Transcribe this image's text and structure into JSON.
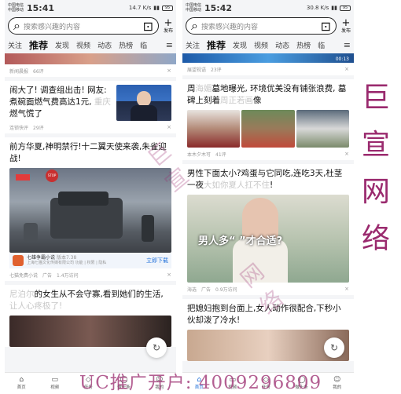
{
  "left": {
    "status": {
      "carrier1": "中国电信",
      "carrier2": "中国移动",
      "time": "15:41",
      "speed": "14.7 K/s",
      "battery": "95"
    },
    "search": {
      "placeholder": "搜索感兴趣的内容"
    },
    "publish_label": "发布",
    "tabs": [
      "关注",
      "推荐",
      "发现",
      "视频",
      "动态",
      "热榜",
      "临"
    ],
    "items": [
      {
        "source": "新闻晨报",
        "comments": "66评"
      },
      {
        "title_a": "闹大了! 调查组出击! 网友:",
        "title_b": "煮碗面燃气费高达1元, ",
        "title_blur": "重庆",
        "title_c": "燃气慌了",
        "source": "连锁快评",
        "comments": "29评"
      },
      {
        "title": "前方华夏,神明禁行!十二翼天使来袭,朱雀迎战!",
        "app_name": "七雄争霸小说",
        "app_ver": "版本7.38",
        "app_dev": "上海七猫文化传媒有限公司",
        "app_links": "功能 | 权限 | 隐私",
        "download": "立即下载",
        "source": "七猫免费小说",
        "ad": "广告",
        "downloads": "1.4万访问"
      },
      {
        "title_blur": "尼泊尔",
        "title_a": "的女生从不会守寡,看到她们的生活,",
        "title_b": "让人心疼极了!"
      }
    ],
    "nav": [
      "首页",
      "视频",
      "任务",
      "微头条",
      "我的"
    ]
  },
  "right": {
    "status": {
      "carrier1": "中国电信",
      "carrier2": "中国移动",
      "time": "15:42",
      "speed": "30.8 K/s",
      "battery": "95"
    },
    "search": {
      "placeholder": "搜索感兴趣的内容"
    },
    "publish_label": "发布",
    "tabs": [
      "关注",
      "推荐",
      "发现",
      "视频",
      "动态",
      "热榜",
      "临"
    ],
    "items": [
      {
        "source": "展望视语",
        "comments": "23评",
        "duration": "00:13"
      },
      {
        "title_a": "周",
        "title_blur1": "海媚",
        "title_b": "墓地曝光, 环境优美没有铺张浪费, 墓碑上刻着",
        "title_blur2": "周正若画",
        "title_c": "像",
        "source": "本木夕木可",
        "comments": "41评"
      },
      {
        "title": "男性下面太小?鸡蛋与它同吃,连吃3天,杜茎一夜",
        "title_blur": "大如你夏人扛不住",
        "title_end": "!",
        "img_text": "男人多“  ”才合适?",
        "source": "海选",
        "ad": "广告",
        "downloads": "0.9万访问"
      },
      {
        "title": "把媳妇抱到台面上,女人动作很配合,下秒小伙却泼了冷水!"
      }
    ],
    "nav": [
      "首页",
      "视频",
      "任务",
      "微头条",
      "我的"
    ]
  },
  "brand": [
    "巨",
    "宣",
    "网",
    "络"
  ],
  "promo_text": "UC推广开户: 4009296809",
  "colors": {
    "brand": "#9a2a6e",
    "accent": "#1e6fd9"
  }
}
